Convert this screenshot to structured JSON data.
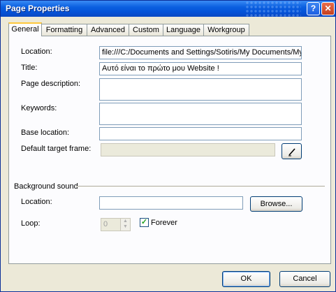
{
  "window": {
    "title": "Page Properties",
    "help_icon": "question-mark",
    "close_icon": "close-x"
  },
  "tabs": [
    {
      "label": "General",
      "active": true
    },
    {
      "label": "Formatting"
    },
    {
      "label": "Advanced"
    },
    {
      "label": "Custom"
    },
    {
      "label": "Language"
    },
    {
      "label": "Workgroup"
    }
  ],
  "general": {
    "location_label": "Location:",
    "location_value": "file:///C:/Documents and Settings/Sotiris/My Documents/My",
    "title_label": "Title:",
    "title_value": "Αυτό είναι το πρώτο μου Website !",
    "description_label": "Page description:",
    "description_value": "",
    "keywords_label": "Keywords:",
    "keywords_value": "",
    "base_location_label": "Base location:",
    "base_location_value": "",
    "target_frame_label": "Default target frame:",
    "target_frame_value": "",
    "target_frame_button_icon": "pencil-icon"
  },
  "background_sound": {
    "section_label": "Background sound",
    "location_label": "Location:",
    "location_value": "",
    "browse_label": "Browse...",
    "loop_label": "Loop:",
    "loop_value": "0",
    "forever_label": "Forever",
    "forever_checked": true
  },
  "footer": {
    "ok_label": "OK",
    "cancel_label": "Cancel"
  }
}
